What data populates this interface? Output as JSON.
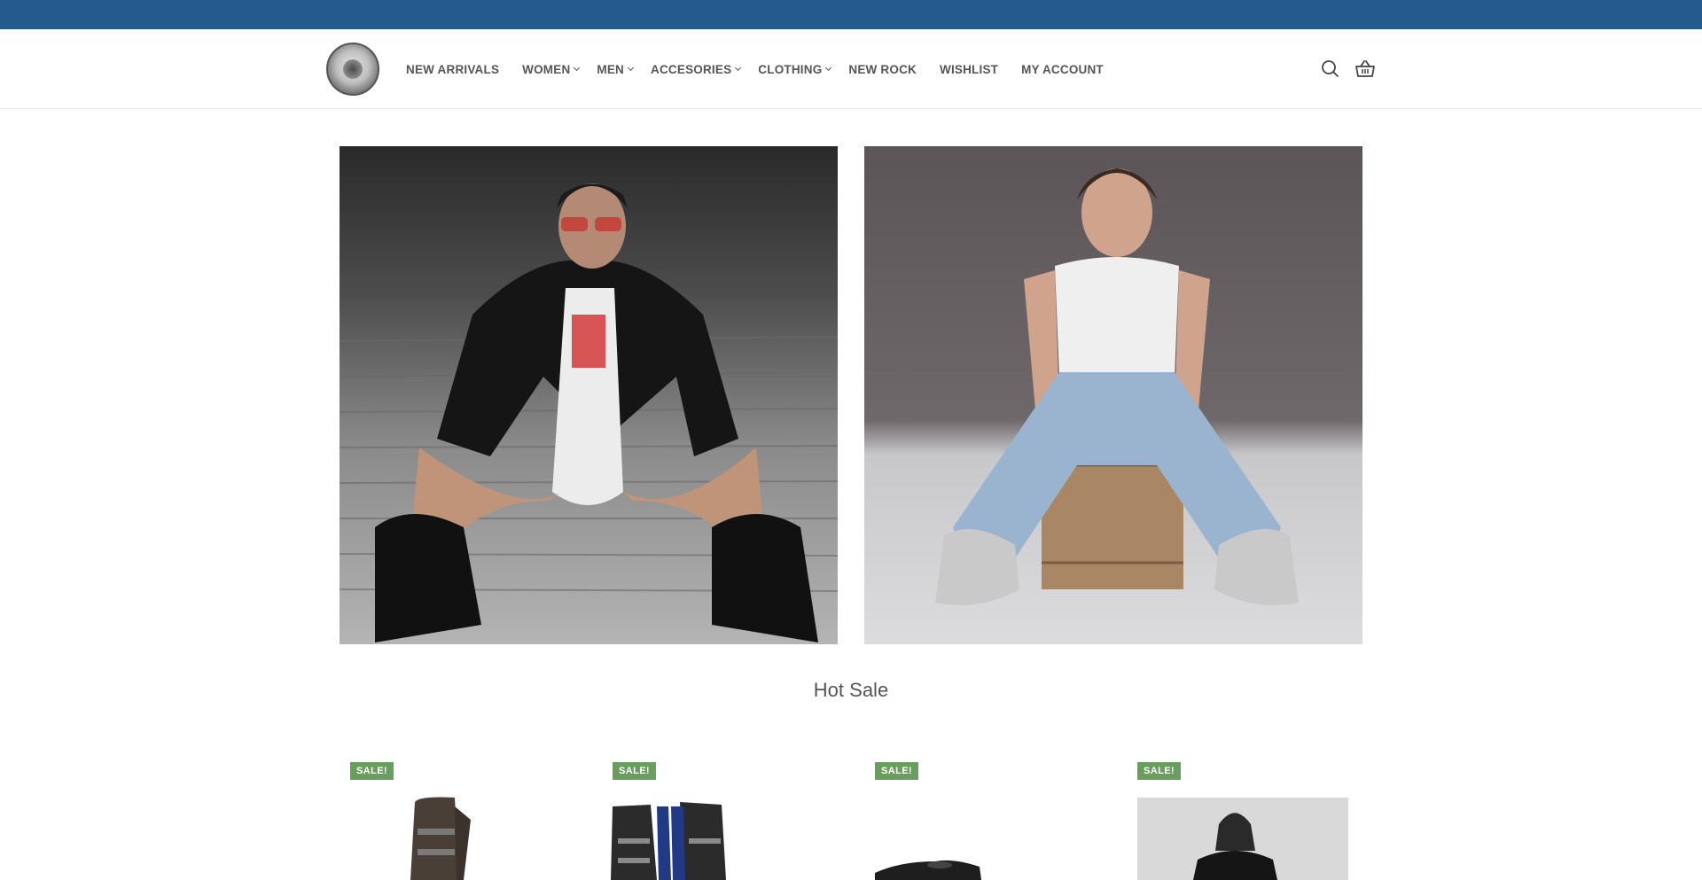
{
  "colors": {
    "topbar": "#255a8e",
    "sale_badge": "#6a9e5f"
  },
  "header": {
    "logo_alt": "New Rock",
    "nav": [
      {
        "label": "NEW ARRIVALS",
        "has_submenu": false
      },
      {
        "label": "WOMEN",
        "has_submenu": true
      },
      {
        "label": "MEN",
        "has_submenu": true
      },
      {
        "label": "ACCESORIES",
        "has_submenu": true
      },
      {
        "label": "CLOTHING",
        "has_submenu": true
      },
      {
        "label": "NEW ROCK",
        "has_submenu": false
      },
      {
        "label": "WISHLIST",
        "has_submenu": false
      },
      {
        "label": "MY ACCOUNT",
        "has_submenu": false
      }
    ],
    "icons": [
      "search-icon",
      "basket-icon",
      "chevron-down-icon"
    ]
  },
  "hot_sale": {
    "title": "Hot Sale",
    "products": [
      {
        "badge": "SALE!"
      },
      {
        "badge": "SALE!"
      },
      {
        "badge": "SALE!"
      },
      {
        "badge": "SALE!"
      }
    ]
  }
}
